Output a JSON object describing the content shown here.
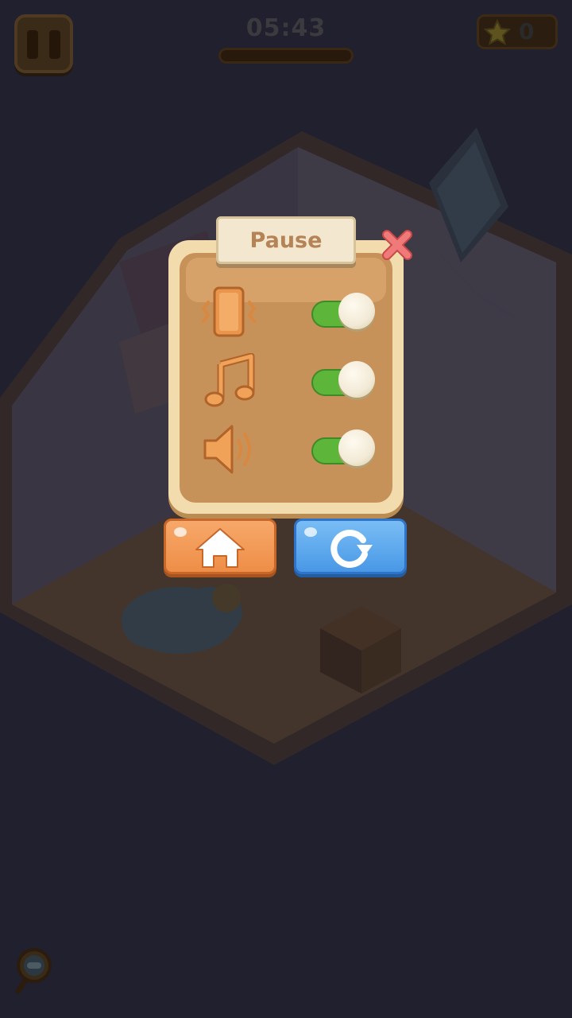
{
  "hud": {
    "timer": "05:43",
    "stars_count": "0",
    "progress": 0.0
  },
  "pause_dialog": {
    "title": "Pause",
    "settings": [
      {
        "name": "vibration",
        "icon": "phone-vibrate-icon",
        "enabled": true
      },
      {
        "name": "music",
        "icon": "music-note-icon",
        "enabled": true
      },
      {
        "name": "sound",
        "icon": "speaker-icon",
        "enabled": true
      }
    ],
    "home_icon": "home-icon",
    "restart_icon": "restart-icon",
    "close_icon": "close-icon"
  },
  "colors": {
    "panel_frame": "#f2dcae",
    "panel_inner": "#c7925a",
    "toggle_on": "#5db53a",
    "home_button": "#ee8e47",
    "restart_button": "#4998e6",
    "close_x": "#ef6b6b"
  }
}
